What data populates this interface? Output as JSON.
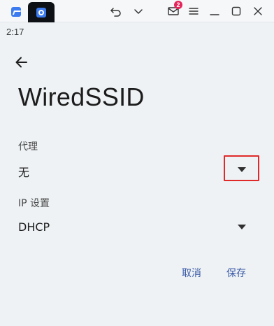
{
  "titlebar": {
    "mail_badge_count": "2",
    "icons": [
      "app-logo-icon",
      "settings-icon",
      "undo-icon",
      "chevron-down-icon",
      "mail-icon",
      "menu-icon",
      "minimize-icon",
      "maximize-icon",
      "close-icon"
    ]
  },
  "status_bar": {
    "time": "2:17"
  },
  "screen": {
    "title": "WiredSSID",
    "proxy": {
      "label": "代理",
      "value": "无"
    },
    "ip_settings": {
      "label": "IP 设置",
      "value": "DHCP"
    },
    "actions": {
      "cancel": "取消",
      "save": "保存"
    }
  },
  "colors": {
    "background": "#eef2f4",
    "accent": "#3b5aa7",
    "highlight": "#e02a2a",
    "badge": "#e5245a"
  }
}
